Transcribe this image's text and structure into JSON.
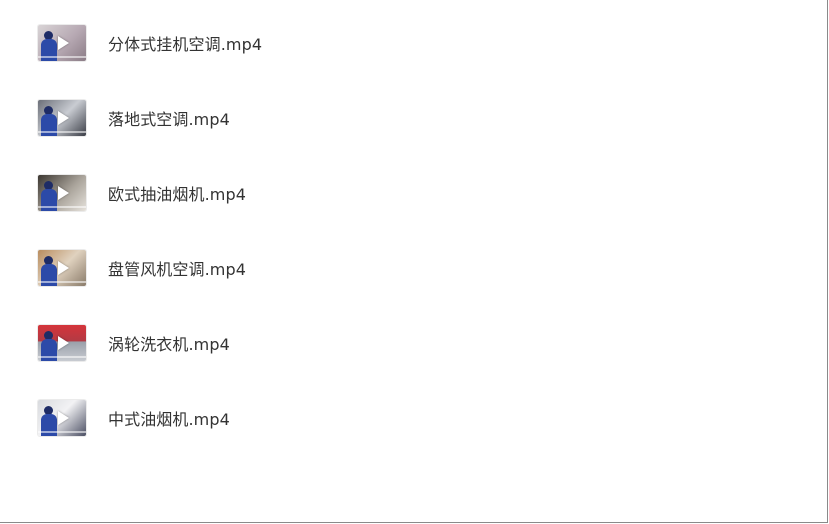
{
  "videos": [
    {
      "title": "分体式挂机空调.mp4",
      "thumb_bg": "linear-gradient(135deg,#d9d4d6 0%,#b7a9b3 55%,#8b7c86 100%)",
      "accent": "#c94a4a"
    },
    {
      "title": "落地式空调.mp4",
      "thumb_bg": "linear-gradient(135deg,#6b6f78 0%,#c9ccd2 50%,#3a3d46 100%)",
      "accent": "#e4e4e4"
    },
    {
      "title": "欧式抽油烟机.mp4",
      "thumb_bg": "linear-gradient(135deg,#3b3630 0%,#a9a39a 55%,#e6e2dc 100%)",
      "accent": "#2b2b2b"
    },
    {
      "title": "盘管风机空调.mp4",
      "thumb_bg": "linear-gradient(135deg,#b98d5e 0%,#e0d2bf 50%,#8a7b6a 100%)",
      "accent": "#d24b3b"
    },
    {
      "title": "涡轮洗衣机.mp4",
      "thumb_bg": "linear-gradient(180deg,#d4343a 0%,#b33a44 45%,#9aa0aa 46%,#c8cbd1 100%)",
      "accent": "#ffffff"
    },
    {
      "title": "中式油烟机.mp4",
      "thumb_bg": "linear-gradient(135deg,#d8dade 0%,#f2f2f4 45%,#4b4f63 100%)",
      "accent": "#2b2b2b"
    }
  ]
}
